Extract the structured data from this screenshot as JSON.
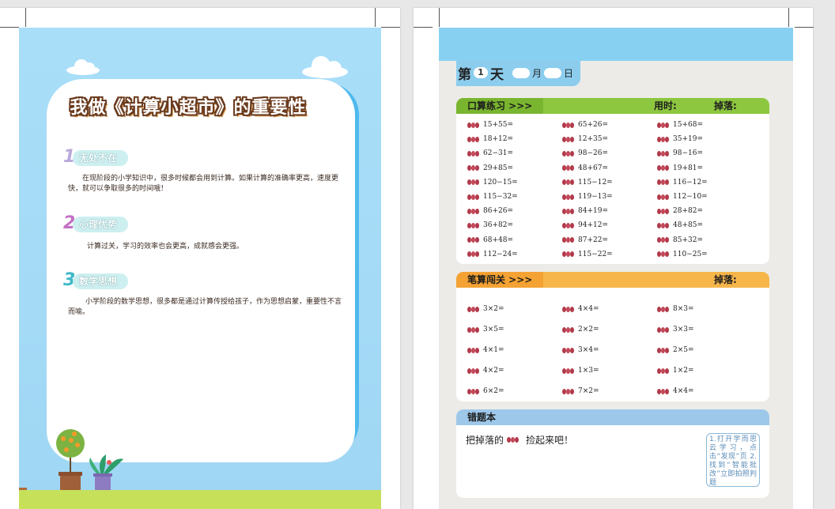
{
  "left_page": {
    "title": "我做《计算小超市》的重要性",
    "sections": [
      {
        "num": "1",
        "heading": "无处不在",
        "body": "在现阶段的小学知识中，很多时候都会用到计算。如果计算的准确率更高，速度更快，就可以争取很多的时间哦！"
      },
      {
        "num": "2",
        "heading": "心理优势",
        "body": "计算过关，学习的效率也会更高，成就感会更强。"
      },
      {
        "num": "3",
        "heading": "数学思想",
        "body": "小学阶段的数学思想，很多都是通过计算传授给孩子，作为思想启蒙，重要性不言而喻。"
      }
    ],
    "colors": {
      "sky": "#a9def8",
      "panel_back": "#4fb9ec",
      "ground": "#c6e05a",
      "num1": "#b9a8d8",
      "num2": "#c36fc4",
      "num3": "#3fb8c8"
    }
  },
  "right_page": {
    "day": {
      "prefix": "第",
      "number": "1",
      "suffix": "天",
      "month": "月",
      "date": "日"
    },
    "oral": {
      "label": "口算练习 >>>",
      "time_label": "用时:",
      "drop_label": "掉落:",
      "columns": [
        [
          "15+55=",
          "18+12=",
          "62−31=",
          "29+85=",
          "120−15=",
          "115−32=",
          "86+26=",
          "36+82=",
          "68+48=",
          "112−24="
        ],
        [
          "65+26=",
          "12+35=",
          "98−26=",
          "48+67=",
          "115−12=",
          "119−13=",
          "84+19=",
          "94+12=",
          "87+22=",
          "115−22="
        ],
        [
          "15+68=",
          "35+19=",
          "98−16=",
          "19+81=",
          "116−12=",
          "112−10=",
          "28+82=",
          "48+85=",
          "85+32=",
          "110−25="
        ]
      ]
    },
    "written": {
      "label": "笔算闯关 >>>",
      "drop_label": "掉落:",
      "columns": [
        [
          "3×2=",
          "3×5=",
          "4×1=",
          "4×2=",
          "6×2="
        ],
        [
          "4×4=",
          "2×2=",
          "3×4=",
          "1×3=",
          "7×2="
        ],
        [
          "8×3=",
          "3×3=",
          "2×5=",
          "1×2=",
          "4×4="
        ]
      ]
    },
    "mistakes": {
      "label": "错题本",
      "prompt_before": "把掉落的",
      "prompt_after": "捡起来吧！",
      "hint": "1.打开学而思云学习，点击“发现”页 2.找到“智能批改”立即拍照判题"
    },
    "colors": {
      "topbar": "#88d0f1",
      "oral_head": "#8dc63f",
      "written_head": "#f7b64a",
      "mistake_head": "#9dc8ea",
      "apple": "#b23a4a"
    }
  }
}
